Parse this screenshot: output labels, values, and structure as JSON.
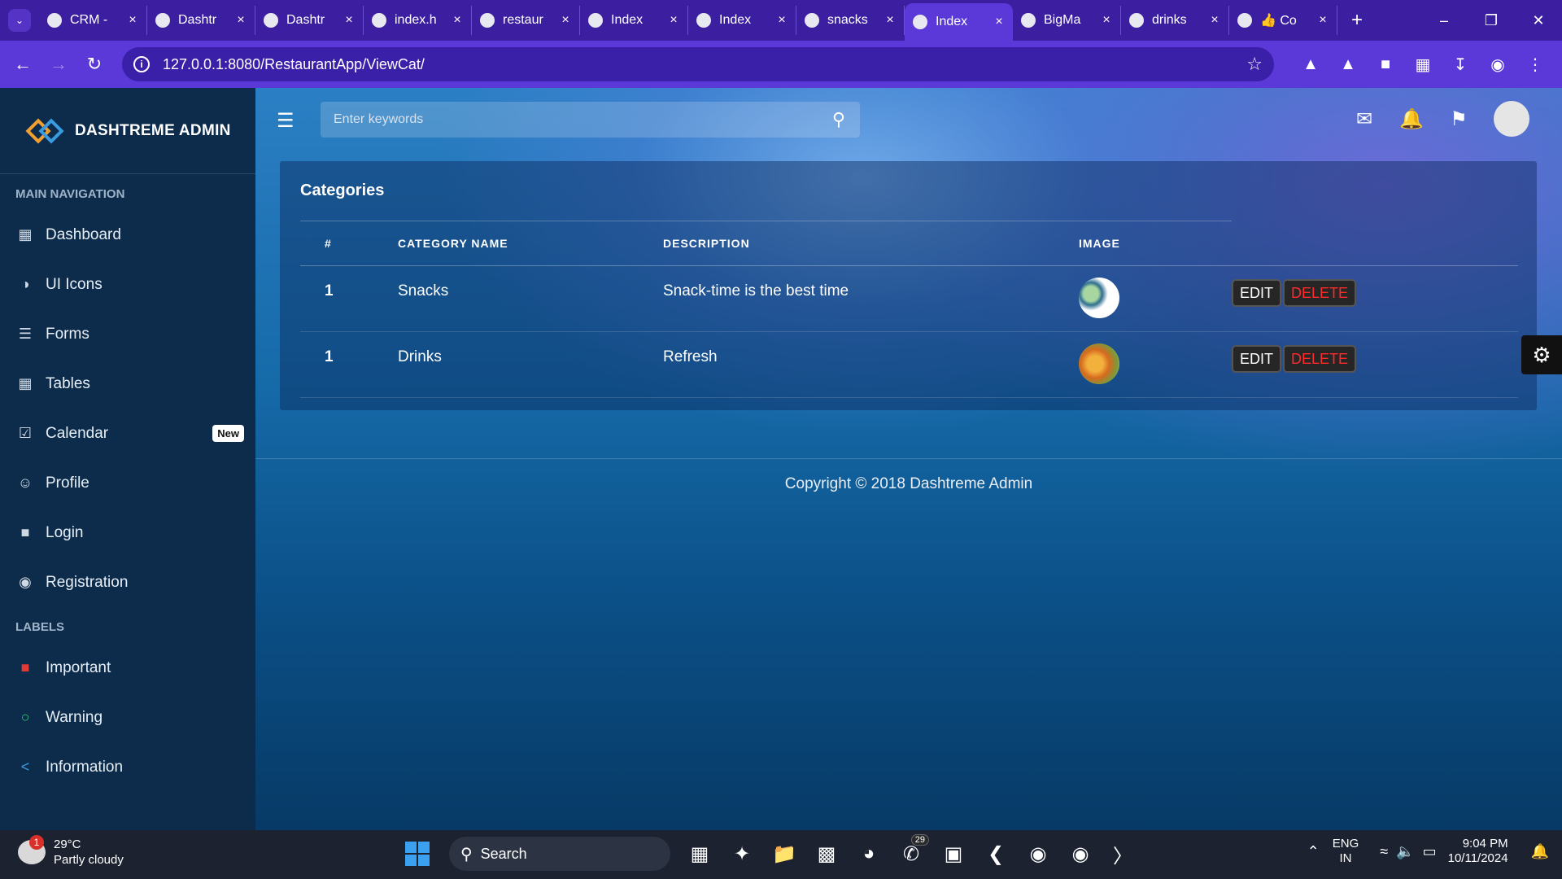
{
  "browser": {
    "tabs": [
      {
        "title": "CRM -",
        "icon": "app-icon"
      },
      {
        "title": "Dashtr",
        "icon": "leaf-icon"
      },
      {
        "title": "Dashtr",
        "icon": "page-icon"
      },
      {
        "title": "index.h",
        "icon": "page-icon"
      },
      {
        "title": "restaur",
        "icon": "google-icon"
      },
      {
        "title": "Index",
        "icon": "globe-icon"
      },
      {
        "title": "Index",
        "icon": "globe-icon"
      },
      {
        "title": "snacks",
        "icon": "google-icon"
      },
      {
        "title": "Index",
        "icon": "globe-icon",
        "active": true
      },
      {
        "title": "BigMa",
        "icon": "page-icon"
      },
      {
        "title": "drinks",
        "icon": "google-icon"
      },
      {
        "title": "👍 Co",
        "icon": "pin-icon"
      }
    ],
    "url": "127.0.0.1:8080/RestaurantApp/ViewCat/"
  },
  "sidebar": {
    "brand": "DASHTREME ADMIN",
    "main_header": "MAIN NAVIGATION",
    "items": [
      {
        "label": "Dashboard",
        "icon": "dashboard-icon"
      },
      {
        "label": "UI Icons",
        "icon": "drop-icon"
      },
      {
        "label": "Forms",
        "icon": "list-icon"
      },
      {
        "label": "Tables",
        "icon": "grid-icon"
      },
      {
        "label": "Calendar",
        "icon": "calendar-icon",
        "badge": "New"
      },
      {
        "label": "Profile",
        "icon": "face-icon"
      },
      {
        "label": "Login",
        "icon": "lock-icon"
      },
      {
        "label": "Registration",
        "icon": "user-icon"
      }
    ],
    "labels_header": "LABELS",
    "labels": [
      {
        "label": "Important",
        "icon": "important-icon",
        "color": "#e53935"
      },
      {
        "label": "Warning",
        "icon": "warning-icon",
        "color": "#2ecc71"
      },
      {
        "label": "Information",
        "icon": "share-icon",
        "color": "#3b9be0"
      }
    ]
  },
  "topbar": {
    "search_placeholder": "Enter keywords"
  },
  "card": {
    "title": "Categories",
    "columns": [
      "#",
      "CATEGORY NAME",
      "DESCRIPTION",
      "IMAGE",
      ""
    ],
    "rows": [
      {
        "num": "1",
        "name": "Snacks",
        "description": "Snack-time is the best time",
        "edit": "EDIT",
        "delete": "DELETE"
      },
      {
        "num": "1",
        "name": "Drinks",
        "description": "Refresh",
        "edit": "EDIT",
        "delete": "DELETE"
      }
    ]
  },
  "footer": "Copyright © 2018 Dashtreme Admin",
  "taskbar": {
    "temp": "29°C",
    "weather": "Partly cloudy",
    "weather_badge": "1",
    "search": "Search",
    "whatsapp_count": "29",
    "lang1": "ENG",
    "lang2": "IN",
    "time": "9:04 PM",
    "date": "10/11/2024"
  }
}
